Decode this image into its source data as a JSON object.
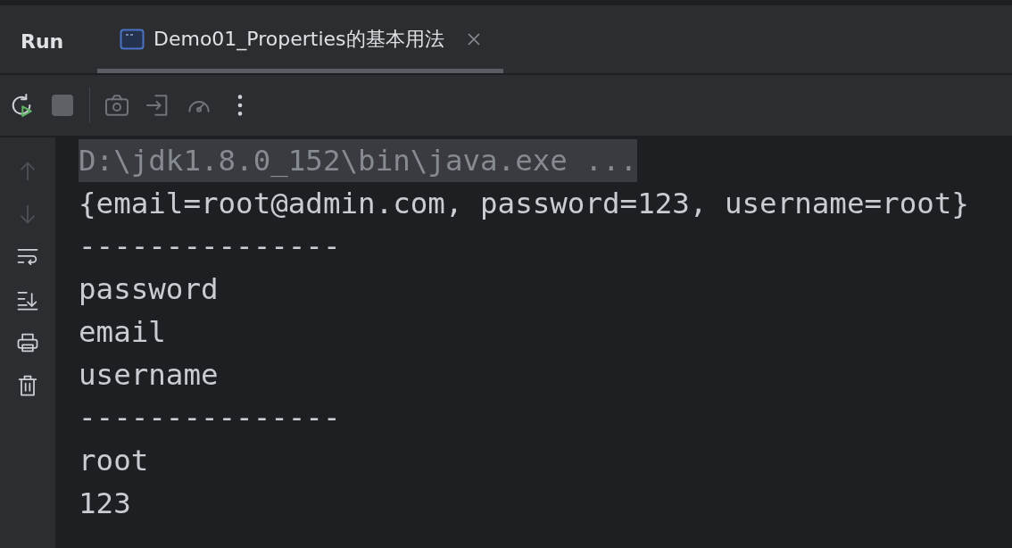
{
  "panel": {
    "title": "Run"
  },
  "tabs": [
    {
      "label": "Demo01_Properties的基本用法",
      "selected": true
    }
  ],
  "console": {
    "lines": [
      {
        "kind": "command",
        "text": "D:\\jdk1.8.0_152\\bin\\java.exe ..."
      },
      {
        "kind": "output",
        "text": "{email=root@admin.com, password=123, username=root}"
      },
      {
        "kind": "output",
        "text": "---------------"
      },
      {
        "kind": "output",
        "text": "password"
      },
      {
        "kind": "output",
        "text": "email"
      },
      {
        "kind": "output",
        "text": "username"
      },
      {
        "kind": "output",
        "text": "---------------"
      },
      {
        "kind": "output",
        "text": "root"
      },
      {
        "kind": "output",
        "text": "123"
      }
    ]
  }
}
